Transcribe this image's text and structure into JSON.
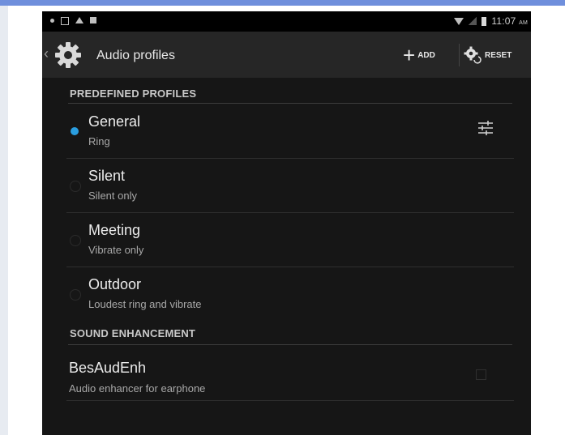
{
  "statusbar": {
    "time": "11:07",
    "ampm": "AM"
  },
  "actionbar": {
    "title": "Audio profiles",
    "add_label": "ADD",
    "reset_label": "RESET"
  },
  "sections": {
    "predefined": "PREDEFINED PROFILES",
    "enhancement": "SOUND ENHANCEMENT"
  },
  "profiles": [
    {
      "title": "General",
      "subtitle": "Ring",
      "selected": true
    },
    {
      "title": "Silent",
      "subtitle": "Silent only",
      "selected": false
    },
    {
      "title": "Meeting",
      "subtitle": "Vibrate only",
      "selected": false
    },
    {
      "title": "Outdoor",
      "subtitle": "Loudest ring and vibrate",
      "selected": false
    }
  ],
  "enhancement_item": {
    "title": "BesAudEnh",
    "subtitle": "Audio enhancer for earphone",
    "checked": false
  },
  "colors": {
    "accent": "#2a9ee0",
    "header_stripe": "#6f8fdc",
    "background": "#161616"
  }
}
